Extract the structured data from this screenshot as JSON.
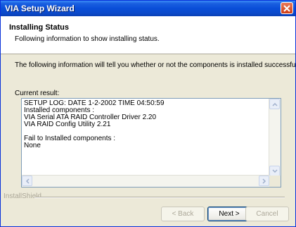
{
  "window": {
    "title": "VIA Setup Wizard"
  },
  "header": {
    "title": "Installing Status",
    "subtitle": "Following information to show installing status."
  },
  "intro": "The following information will tell you whether or not the components is installed successfully .",
  "current_result_label": "Current result:",
  "log_lines": [
    "SETUP LOG:  DATE 1-2-2002 TIME 04:50:59",
    "Installed components :",
    "VIA Serial ATA RAID Controller Driver  2.20",
    "VIA RAID Config Utility  2.21",
    "",
    "Fail to Installed components :",
    "None"
  ],
  "footer_brand": "InstallShield",
  "buttons": {
    "back": "< Back",
    "next": "Next >",
    "cancel": "Cancel"
  },
  "colors": {
    "title_bar": "#0a4ed8",
    "close_button": "#cf3d14",
    "dialog_bg": "#ece9d8"
  }
}
